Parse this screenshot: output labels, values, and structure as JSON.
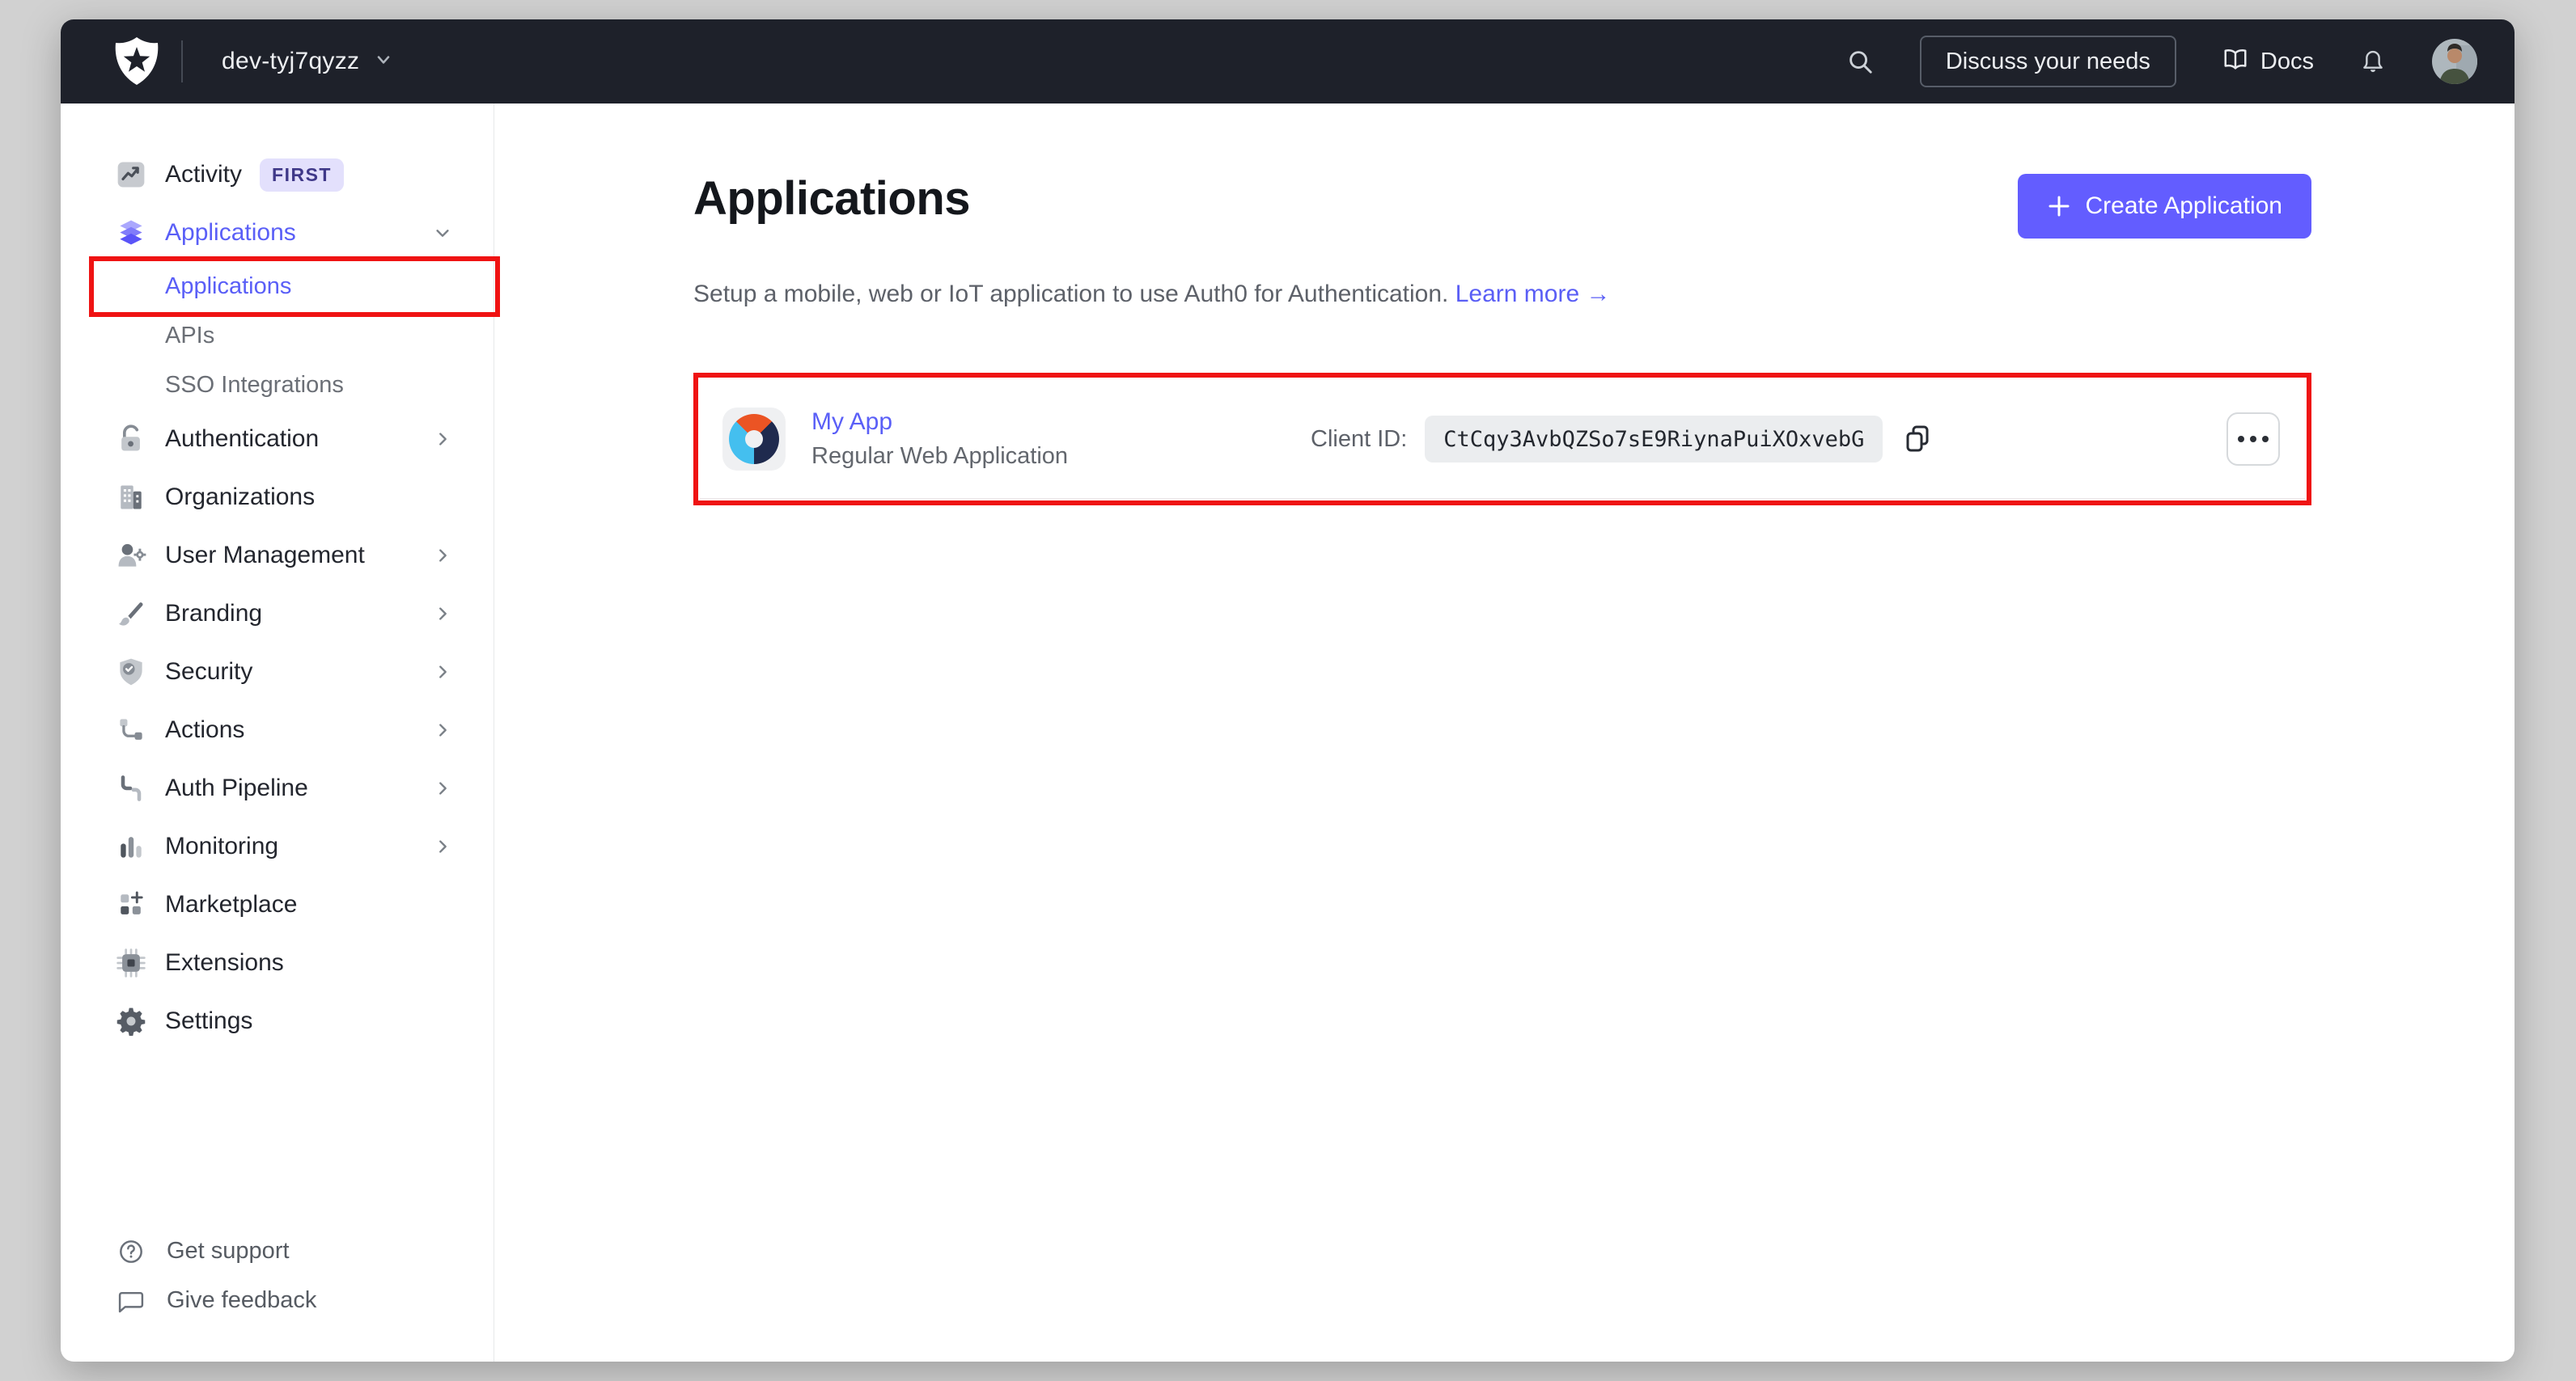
{
  "topbar": {
    "tenant": "dev-tyj7qyzz",
    "discuss_label": "Discuss your needs",
    "docs_label": "Docs"
  },
  "sidebar": {
    "items": [
      {
        "label": "Activity",
        "badge": "FIRST"
      },
      {
        "label": "Applications",
        "active": true
      },
      {
        "label": "Applications",
        "sub": true,
        "active": true,
        "annotated": true
      },
      {
        "label": "APIs",
        "sub": true
      },
      {
        "label": "SSO Integrations",
        "sub": true
      },
      {
        "label": "Authentication"
      },
      {
        "label": "Organizations"
      },
      {
        "label": "User Management"
      },
      {
        "label": "Branding"
      },
      {
        "label": "Security"
      },
      {
        "label": "Actions"
      },
      {
        "label": "Auth Pipeline"
      },
      {
        "label": "Monitoring"
      },
      {
        "label": "Marketplace"
      },
      {
        "label": "Extensions"
      },
      {
        "label": "Settings"
      }
    ],
    "footer": [
      {
        "label": "Get support"
      },
      {
        "label": "Give feedback"
      }
    ]
  },
  "main": {
    "title": "Applications",
    "create_button": "Create Application",
    "subtitle": "Setup a mobile, web or IoT application to use Auth0 for Authentication.",
    "learn_more": "Learn more",
    "learn_more_arrow": "→",
    "app": {
      "name": "My App",
      "type": "Regular Web Application",
      "client_id_label": "Client ID:",
      "client_id": "CtCqy3AvbQZSo7sE9RiynaPuiXOxvebG"
    }
  },
  "colors": {
    "accent": "#635dff",
    "active_link": "#5a5ff7",
    "topbar_bg": "#1e212a",
    "annotation_red": "#ef1313",
    "badge_bg": "#e3e0fc",
    "badge_text": "#3f3888",
    "app_logo_orange": "#eb5424",
    "app_logo_navy": "#1f2a4e",
    "app_logo_blue": "#44bfef",
    "canvas_bg": "#d1d1d1"
  }
}
